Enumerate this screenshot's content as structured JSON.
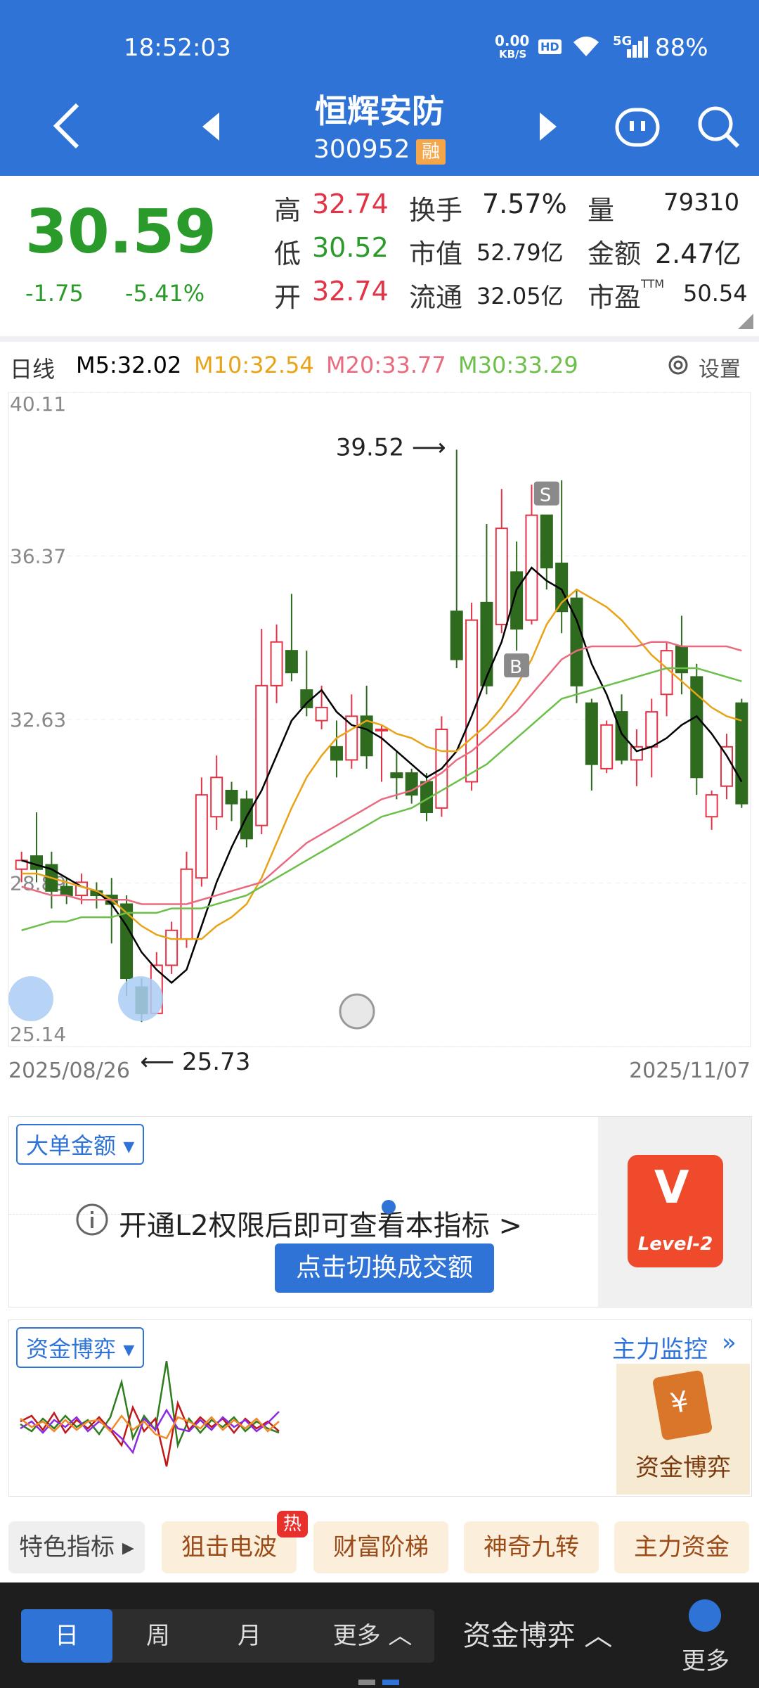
{
  "status": {
    "time": "18:52:03",
    "net_speed_top": "0.00",
    "net_speed_bottom": "KB/S",
    "hd": "HD",
    "signal": "5G",
    "battery": "88%"
  },
  "header": {
    "name": "恒辉安防",
    "code": "300952",
    "badge": "融"
  },
  "quote": {
    "price": "30.59",
    "change": "-1.75",
    "change_pct": "-5.41%",
    "high_label": "高",
    "high": "32.74",
    "low_label": "低",
    "low": "30.52",
    "open_label": "开",
    "open": "32.74",
    "turnover_label": "换手",
    "turnover": "7.57%",
    "mktcap_label": "市值",
    "mktcap": "52.79亿",
    "float_label": "流通",
    "float": "32.05亿",
    "vol_label": "量",
    "vol": "79310",
    "amount_label": "金额",
    "amount": "2.47亿",
    "pe_label": "市盈",
    "pe_sup": "TTM",
    "pe": "50.54"
  },
  "chart_header": {
    "period": "日线",
    "m5": "M5:32.02",
    "m10": "M10:32.54",
    "m20": "M20:33.77",
    "m30": "M30:33.29",
    "settings": "设置"
  },
  "colors": {
    "up": "#e33346",
    "down": "#2e6b1f",
    "m5": "#000000",
    "m10": "#e8a317",
    "m20": "#e86b7f",
    "m30": "#6cc04a",
    "accent": "#2f73d6"
  },
  "chart_data": {
    "type": "candlestick",
    "y_ticks": [
      "40.11",
      "36.37",
      "32.63",
      "28.89",
      "25.14"
    ],
    "ylim": [
      25.14,
      40.11
    ],
    "x_start": "2025/08/26",
    "x_end": "2025/11/07",
    "max_label": "39.52",
    "min_label": "25.73",
    "markers": [
      "S",
      "B"
    ],
    "candles": [
      {
        "o": 29.2,
        "c": 29.4,
        "h": 29.6,
        "l": 28.9
      },
      {
        "o": 29.5,
        "c": 29.2,
        "h": 30.5,
        "l": 28.9
      },
      {
        "o": 29.3,
        "c": 28.7,
        "h": 29.6,
        "l": 28.3
      },
      {
        "o": 28.8,
        "c": 28.6,
        "h": 29.0,
        "l": 28.4
      },
      {
        "o": 28.6,
        "c": 28.9,
        "h": 29.1,
        "l": 28.4
      },
      {
        "o": 28.7,
        "c": 28.6,
        "h": 28.9,
        "l": 28.3
      },
      {
        "o": 28.6,
        "c": 28.4,
        "h": 29.0,
        "l": 27.5
      },
      {
        "o": 28.4,
        "c": 26.7,
        "h": 28.6,
        "l": 26.3
      },
      {
        "o": 26.5,
        "c": 25.9,
        "h": 26.7,
        "l": 25.7
      },
      {
        "o": 25.9,
        "c": 27.0,
        "h": 27.3,
        "l": 25.9
      },
      {
        "o": 27.0,
        "c": 27.8,
        "h": 28.0,
        "l": 26.8
      },
      {
        "o": 27.6,
        "c": 29.2,
        "h": 29.6,
        "l": 27.4
      },
      {
        "o": 29.0,
        "c": 30.9,
        "h": 31.3,
        "l": 28.8
      },
      {
        "o": 30.4,
        "c": 31.3,
        "h": 31.8,
        "l": 30.1
      },
      {
        "o": 31.0,
        "c": 30.7,
        "h": 31.2,
        "l": 30.3
      },
      {
        "o": 30.8,
        "c": 29.9,
        "h": 31.0,
        "l": 29.7
      },
      {
        "o": 30.2,
        "c": 33.4,
        "h": 34.7,
        "l": 30.0
      },
      {
        "o": 33.4,
        "c": 34.4,
        "h": 34.8,
        "l": 33.0
      },
      {
        "o": 34.2,
        "c": 33.7,
        "h": 35.5,
        "l": 33.5
      },
      {
        "o": 33.3,
        "c": 32.9,
        "h": 34.2,
        "l": 32.7
      },
      {
        "o": 32.6,
        "c": 32.9,
        "h": 33.4,
        "l": 32.4
      },
      {
        "o": 32.0,
        "c": 31.7,
        "h": 32.6,
        "l": 31.3
      },
      {
        "o": 31.7,
        "c": 32.7,
        "h": 33.2,
        "l": 31.5
      },
      {
        "o": 32.7,
        "c": 31.8,
        "h": 33.4,
        "l": 31.5
      },
      {
        "o": 32.4,
        "c": 32.4,
        "h": 32.5,
        "l": 31.2
      },
      {
        "o": 31.4,
        "c": 31.3,
        "h": 31.9,
        "l": 30.8
      },
      {
        "o": 31.4,
        "c": 30.9,
        "h": 31.5,
        "l": 30.7
      },
      {
        "o": 31.2,
        "c": 30.5,
        "h": 31.4,
        "l": 30.3
      },
      {
        "o": 30.6,
        "c": 32.4,
        "h": 32.7,
        "l": 30.4
      },
      {
        "o": 35.1,
        "c": 34.0,
        "h": 38.8,
        "l": 33.8
      },
      {
        "o": 31.2,
        "c": 34.9,
        "h": 35.3,
        "l": 31.0
      },
      {
        "o": 35.3,
        "c": 33.4,
        "h": 37.1,
        "l": 33.2
      },
      {
        "o": 34.8,
        "c": 37.0,
        "h": 37.9,
        "l": 34.6
      },
      {
        "o": 36.0,
        "c": 34.7,
        "h": 36.7,
        "l": 34.2
      },
      {
        "o": 34.9,
        "c": 37.3,
        "h": 38.0,
        "l": 34.8
      },
      {
        "o": 37.3,
        "c": 36.1,
        "h": 37.3,
        "l": 35.6
      },
      {
        "o": 36.2,
        "c": 35.1,
        "h": 38.1,
        "l": 34.6
      },
      {
        "o": 35.4,
        "c": 33.4,
        "h": 35.6,
        "l": 33.0
      },
      {
        "o": 33.0,
        "c": 31.6,
        "h": 33.1,
        "l": 31.0
      },
      {
        "o": 31.5,
        "c": 32.5,
        "h": 32.6,
        "l": 31.4
      },
      {
        "o": 32.8,
        "c": 31.7,
        "h": 33.2,
        "l": 31.6
      },
      {
        "o": 31.7,
        "c": 32.0,
        "h": 32.4,
        "l": 31.1
      },
      {
        "o": 32.0,
        "c": 32.8,
        "h": 33.1,
        "l": 31.3
      },
      {
        "o": 33.2,
        "c": 34.2,
        "h": 34.4,
        "l": 32.7
      },
      {
        "o": 34.3,
        "c": 33.7,
        "h": 35.0,
        "l": 33.2
      },
      {
        "o": 33.6,
        "c": 31.3,
        "h": 33.9,
        "l": 30.9
      },
      {
        "o": 30.4,
        "c": 30.9,
        "h": 31.0,
        "l": 30.1
      },
      {
        "o": 31.1,
        "c": 32.0,
        "h": 32.3,
        "l": 30.8
      },
      {
        "o": 33.0,
        "c": 30.7,
        "h": 33.1,
        "l": 30.6
      }
    ],
    "series": [
      {
        "name": "M5",
        "values": [
          29.4,
          29.3,
          29.2,
          29.0,
          28.8,
          28.7,
          28.4,
          27.9,
          27.3,
          26.9,
          26.6,
          26.9,
          27.9,
          28.9,
          29.7,
          30.4,
          31.0,
          31.8,
          32.6,
          33.0,
          33.3,
          32.8,
          32.5,
          32.4,
          32.2,
          31.9,
          31.6,
          31.3,
          31.5,
          31.9,
          32.7,
          33.6,
          34.4,
          35.6,
          36.1,
          35.8,
          35.6,
          34.9,
          33.9,
          33.2,
          32.3,
          31.9,
          32.0,
          32.2,
          32.5,
          32.7,
          32.3,
          31.8,
          31.2
        ]
      },
      {
        "name": "M10",
        "values": [
          29.1,
          29.1,
          29.0,
          28.9,
          28.8,
          28.7,
          28.5,
          28.2,
          27.9,
          27.7,
          27.6,
          27.6,
          27.6,
          27.9,
          28.1,
          28.4,
          29.0,
          29.8,
          30.6,
          31.3,
          31.8,
          32.2,
          32.4,
          32.6,
          32.5,
          32.3,
          32.2,
          32.0,
          31.9,
          31.9,
          32.2,
          32.5,
          32.9,
          33.4,
          34.0,
          34.8,
          35.3,
          35.6,
          35.4,
          35.2,
          34.9,
          34.5,
          34.1,
          33.8,
          33.5,
          33.2,
          32.9,
          32.7,
          32.6
        ]
      },
      {
        "name": "M20",
        "values": [
          28.8,
          28.7,
          28.6,
          28.6,
          28.5,
          28.5,
          28.5,
          28.5,
          28.4,
          28.4,
          28.4,
          28.4,
          28.5,
          28.6,
          28.7,
          28.8,
          28.9,
          29.2,
          29.5,
          29.8,
          30.0,
          30.2,
          30.4,
          30.6,
          30.8,
          30.9,
          31.0,
          31.2,
          31.4,
          31.7,
          31.9,
          32.2,
          32.5,
          32.8,
          33.2,
          33.6,
          34.0,
          34.2,
          34.3,
          34.3,
          34.3,
          34.3,
          34.4,
          34.4,
          34.3,
          34.3,
          34.3,
          34.3,
          34.2
        ]
      },
      {
        "name": "M30",
        "values": [
          27.8,
          27.9,
          28.0,
          28.0,
          28.1,
          28.1,
          28.1,
          28.2,
          28.2,
          28.2,
          28.3,
          28.3,
          28.3,
          28.4,
          28.5,
          28.6,
          28.8,
          29.0,
          29.2,
          29.4,
          29.6,
          29.8,
          30.0,
          30.2,
          30.4,
          30.5,
          30.6,
          30.8,
          31.0,
          31.2,
          31.4,
          31.6,
          31.9,
          32.2,
          32.5,
          32.8,
          33.1,
          33.2,
          33.3,
          33.4,
          33.5,
          33.6,
          33.7,
          33.8,
          33.8,
          33.8,
          33.7,
          33.6,
          33.5
        ]
      }
    ]
  },
  "panel1": {
    "dropdown": "大单金额",
    "message": "开通L2权限后即可查看本指标 >",
    "tooltip": "点击切换成交额",
    "badge_text": "Level-2"
  },
  "panel2": {
    "dropdown": "资金博弈",
    "monitor": "主力监控",
    "promo": "资金博弈"
  },
  "tags": {
    "first": "特色指标",
    "items": [
      "狙击电波",
      "财富阶梯",
      "神奇九转",
      "主力资金"
    ],
    "hot": "热"
  },
  "bottom": {
    "periods": [
      "日",
      "周",
      "月"
    ],
    "more": "更多",
    "indicator": "资金博弈",
    "more_btn": "更多"
  }
}
